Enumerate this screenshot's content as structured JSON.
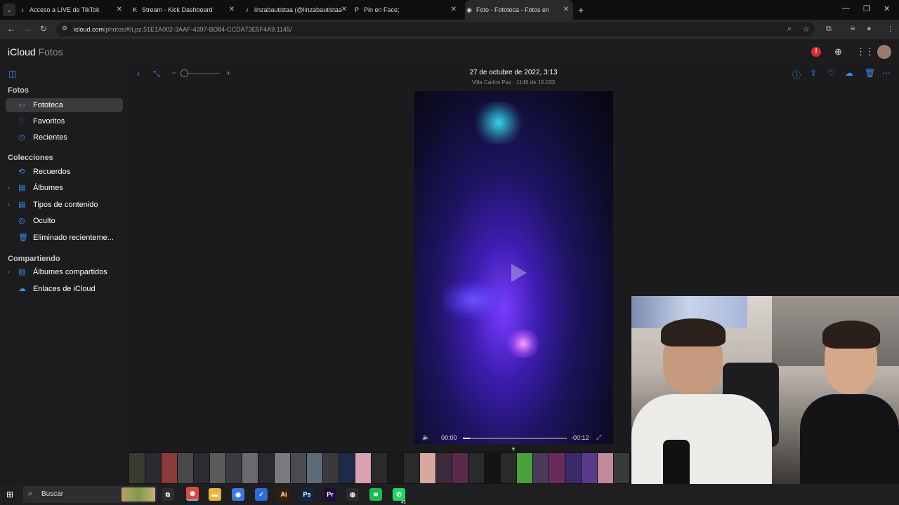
{
  "browser": {
    "tabs": [
      {
        "label": "Acceso a LIVE de TikTok",
        "icon": "tiktok-icon",
        "icon_glyph": "♪"
      },
      {
        "label": "Stream - Kick Dashboard",
        "icon": "kick-icon",
        "icon_glyph": "K"
      },
      {
        "label": "iinzabautistaa (@iinzabautistaa",
        "icon": "tiktok-icon",
        "icon_glyph": "♪"
      },
      {
        "label": "Pin en Face;",
        "icon": "pinterest-icon",
        "icon_glyph": "P"
      },
      {
        "label": "Foto - Fototeca - Fotos en",
        "icon": "icloud-icon",
        "icon_glyph": "◉"
      }
    ],
    "url_host": "icloud.com",
    "url_path": "/photos/#/i.pz.51E1A002-3AAF-4397-BD84-CCDA73E5F4A9.1145/"
  },
  "app": {
    "brand_prefix": "iCloud",
    "brand_suffix": "Fotos"
  },
  "sidebar": {
    "sections": [
      {
        "title": "Fotos",
        "items": [
          {
            "label": "Fototeca",
            "icon": "photo-library-icon",
            "glyph": "▭",
            "selected": true
          },
          {
            "label": "Favoritos",
            "icon": "heart-icon",
            "glyph": "♡"
          },
          {
            "label": "Recientes",
            "icon": "clock-icon",
            "glyph": "◷"
          }
        ]
      },
      {
        "title": "Colecciones",
        "items": [
          {
            "label": "Recuerdos",
            "icon": "memories-icon",
            "glyph": "⟲"
          },
          {
            "label": "Álbumes",
            "icon": "album-icon",
            "glyph": "▤",
            "expandable": true
          },
          {
            "label": "Tipos de contenido",
            "icon": "media-types-icon",
            "glyph": "▤",
            "expandable": true
          },
          {
            "label": "Oculto",
            "icon": "eye-slash-icon",
            "glyph": "◎"
          },
          {
            "label": "Eliminado recienteme...",
            "icon": "trash-icon",
            "glyph": "🗑"
          }
        ]
      },
      {
        "title": "Compartiendo",
        "items": [
          {
            "label": "Álbumes compartidos",
            "icon": "shared-album-icon",
            "glyph": "▤",
            "expandable": true
          },
          {
            "label": "Enlaces de iCloud",
            "icon": "cloud-link-icon",
            "glyph": "☁"
          }
        ]
      }
    ]
  },
  "photo": {
    "title": "27 de octubre de 2022, 3:13",
    "subtitle": "Villa Carlos Paz · 1146 de 15.033"
  },
  "video": {
    "time_elapsed": "00:00",
    "time_remaining": "-00:12",
    "progress": 0.07
  },
  "taskbar": {
    "search_placeholder": "Buscar",
    "apps": [
      {
        "name": "task-view-icon",
        "glyph": "⧉",
        "color": "#2e2e31"
      },
      {
        "name": "chrome-icon",
        "glyph": "◉",
        "color": "#d94b3b",
        "active": true
      },
      {
        "name": "file-explorer-icon",
        "glyph": "▬",
        "color": "#e6b73c"
      },
      {
        "name": "chrome-icon",
        "glyph": "◉",
        "color": "#3b7ad9"
      },
      {
        "name": "tasks-icon",
        "glyph": "✓",
        "color": "#2e6bd9"
      },
      {
        "name": "illustrator-icon",
        "glyph": "Ai",
        "color": "#3a1d04"
      },
      {
        "name": "photoshop-icon",
        "glyph": "Ps",
        "color": "#0b2a4a"
      },
      {
        "name": "premiere-icon",
        "glyph": "Pr",
        "color": "#1f0d3a"
      },
      {
        "name": "obs-icon",
        "glyph": "◍",
        "color": "#2b2b2e"
      },
      {
        "name": "spotify-icon",
        "glyph": "≋",
        "color": "#1db954"
      },
      {
        "name": "whatsapp-icon",
        "glyph": "✆",
        "color": "#25d366"
      }
    ],
    "whatsapp_badge": "45"
  },
  "filmstrip_colors": [
    "#3a3a2e",
    "#2c2a30",
    "#8a3a3a",
    "#4a4a4a",
    "#2c2c30",
    "#5a5a5a",
    "#3a3a42",
    "#6a6a70",
    "#2a2a2e",
    "#7a7a80",
    "#4a4a50",
    "#5c6a7a",
    "#3a3a3a",
    "#1e2a4a",
    "#d8a0b0",
    "#2a2a2a",
    "#1a1a1c",
    "#2a2a2c",
    "#d8a8a0",
    "#3a2a3a",
    "#5a2a4a",
    "#2a2a2c",
    "#141414",
    "#2a2a2a",
    "#4aa03a",
    "#4a3a5a",
    "#6a2a5a",
    "#3a2a6a",
    "#5a3a8a",
    "#c08a9a",
    "#3a3a3a"
  ]
}
